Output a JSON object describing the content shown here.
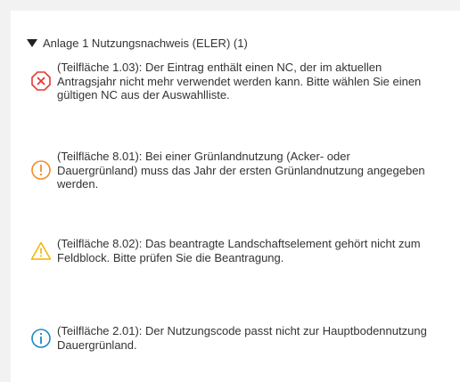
{
  "section": {
    "title": "Anlage 1 Nutzungsnachweis (ELER) (1)"
  },
  "messages": [
    {
      "severity": "error",
      "icon": "error-x-icon",
      "color": "#e53935",
      "text": "(Teilfläche 1.03): Der Eintrag enthält einen NC, der im aktuellen Antragsjahr nicht mehr verwendet werden kann. Bitte wählen Sie einen gültigen NC aus der Auswahlliste."
    },
    {
      "severity": "warning-orange",
      "icon": "exclamation-circle-icon",
      "color": "#f28c28",
      "text": "(Teilfläche 8.01): Bei einer Grünlandnutzung (Acker- oder Dauergrünland) muss das Jahr der ersten Grünlandnutzung angegeben werden."
    },
    {
      "severity": "warning",
      "icon": "warning-triangle-icon",
      "color": "#f4b400",
      "text": "(Teilfläche 8.02): Das beantragte Landschaftselement gehört nicht zum Feldblock. Bitte prüfen Sie die Beantragung."
    },
    {
      "severity": "info",
      "icon": "info-circle-icon",
      "color": "#1e88c8",
      "text": "(Teilfläche 2.01): Der Nutzungscode passt nicht zur Hauptbodennutzung Dauergrünland."
    }
  ]
}
